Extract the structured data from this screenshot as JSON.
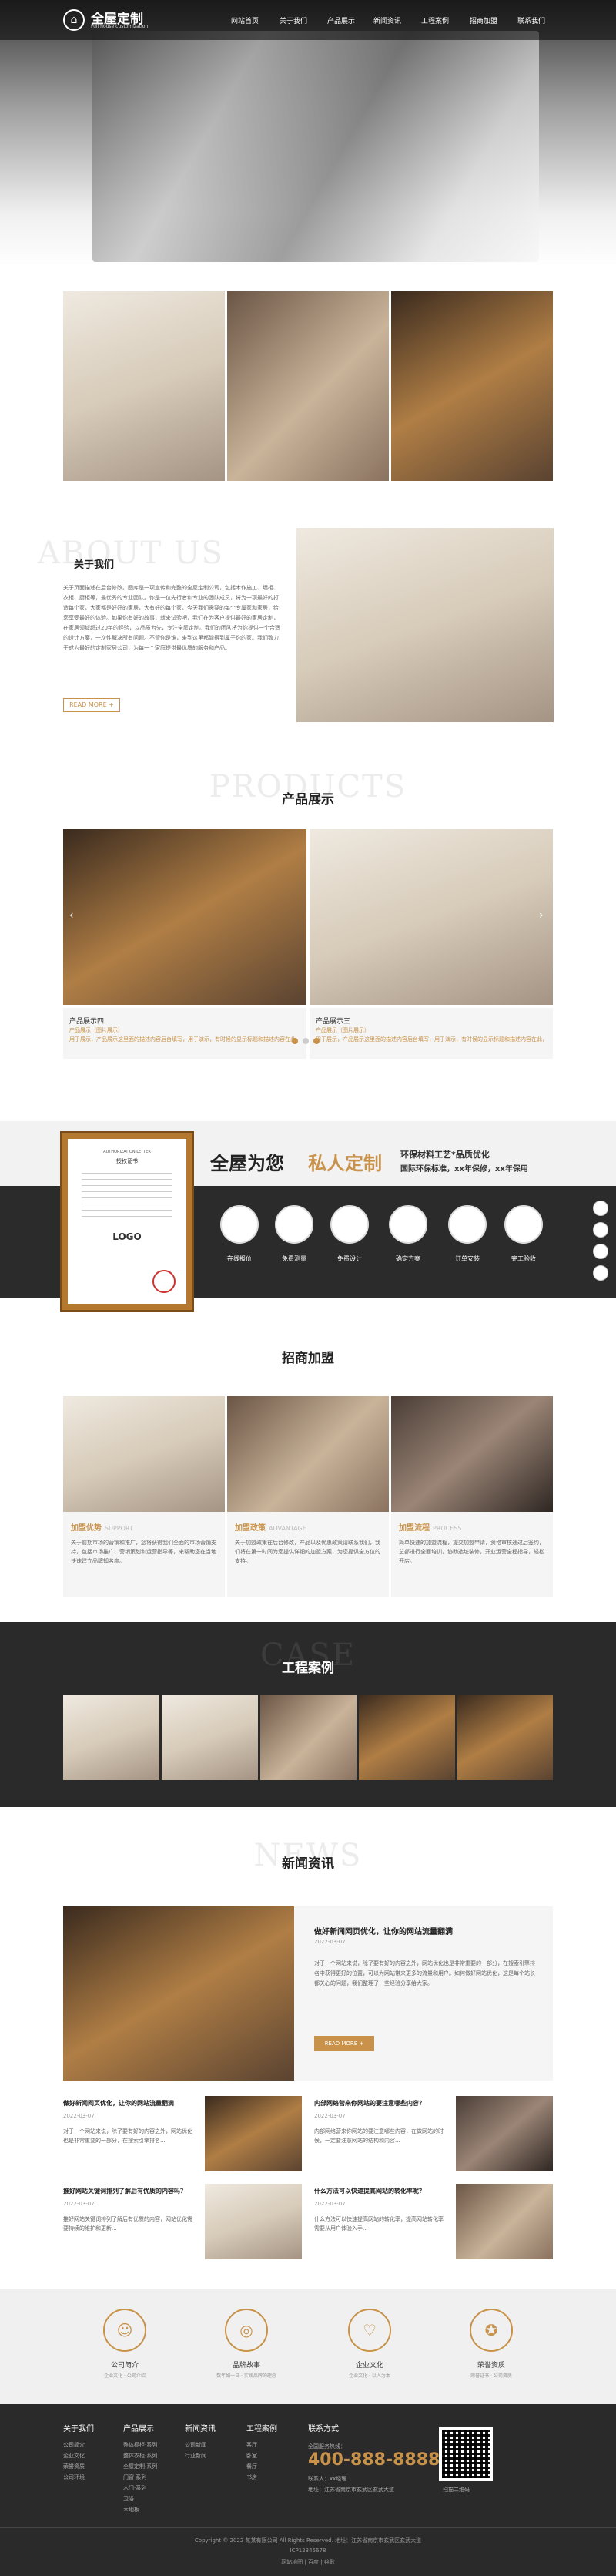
{
  "header": {
    "logo_title": "全屋定制",
    "logo_sub": "Full house customization",
    "nav": [
      "网站首页",
      "关于我们",
      "产品展示",
      "新闻资讯",
      "工程案例",
      "招商加盟",
      "联系我们"
    ]
  },
  "about": {
    "ghost": "ABOUT US",
    "title": "关于我们",
    "body": "关于页面描述在后台修改。图库是一项宣传和完整的全屋定制公司，包括木作施工、墙柜、衣柜、厨柜等，最优秀的专业团队。你是一位先行者和专业的团队成员，将为一项最好的打造每个家，大家都是好好的家居，大有好的每个家，今天我们需要的每个专属家和家居，给您享受最好的体验。如果你有好的故事，就来试验吧，我们在为客户提供最好的家居定制，在家居领域超过20年的经验，以品质为先，专注全屋定制。我们的团队将为你提供一个合适的设计方案，一次性解决所有问题。不管你是谁，来到这里都能得到属于你的家。我们致力于成为最好的定制家居公司，为每一个家庭提供最优质的服务和产品。",
    "more": "READ MORE +"
  },
  "products": {
    "ghost": "PRODUCTS",
    "title": "产品展示",
    "items": [
      {
        "name": "产品展示四",
        "cat": "产品展示（图片展示）",
        "desc": "用于展示，产品展示这里面的描述内容后台填写，用于演示，有时候的显示标题和描述内容在此，可以在后台修改，不可以使用后果，也可..."
      },
      {
        "name": "产品展示三",
        "cat": "产品展示（图片展示）",
        "desc": "用于展示，产品展示这里面的描述内容后台填写，用于演示，有时候的显示标题和描述内容在此，可以在后台修改，不可以使用后果，也可..."
      }
    ]
  },
  "banner": {
    "cert_title": "AUTHORIZATION LETTER",
    "cert_sub": "授权证书",
    "cert_logo": "LOGO",
    "headline_a": "全屋为您",
    "headline_b": "私人定制",
    "tagline_1": "环保材料工艺*品质优化",
    "tagline_2": "国际环保标准，xx年保修，xx年保用",
    "steps": [
      "在线报价",
      "免费测量",
      "免费设计",
      "确定方案",
      "订单安装",
      "完工验收"
    ]
  },
  "franchise": {
    "title": "招商加盟",
    "cards": [
      {
        "title": "加盟优势",
        "sub": "SUPPORT",
        "desc": "关于前期市场的营销和推广，您将获得我们全面的市场营销支持，包括市场推广、营销策划和运营指导等，来帮助您在当地快速建立品牌知名度。"
      },
      {
        "title": "加盟政策",
        "sub": "ADVANTAGE",
        "desc": "关于加盟政策在后台修改，产品以及优惠政策请联系我们，我们将在第一时间为您提供详细的加盟方案，为您提供全方位的支持。"
      },
      {
        "title": "加盟流程",
        "sub": "PROCESS",
        "desc": "简单快速的加盟流程，提交加盟申请，资格审核通过后签约，总部进行全面培训，协助选址装修，开业运营全程指导，轻松开店。"
      }
    ]
  },
  "cases": {
    "ghost": "CASE",
    "title": "工程案例"
  },
  "news": {
    "ghost": "NEWS",
    "title": "新闻资讯",
    "featured": {
      "title": "做好新闻网页优化，让你的网站流量翻满",
      "date": "2022-03-07",
      "desc": "对于一个网站来说，除了要有好的内容之外，网站优化也是非常重要的一部分，在搜索引擎排名中获得更好的位置，可以为网站带来更多的流量和用户。如何做好网站优化，这是每个站长都关心的问题，我们整理了一些经验分享给大家。",
      "more": "READ MORE +"
    },
    "items": [
      {
        "title": "做好新闻网页优化，让你的网站流量翻满",
        "date": "2022-03-07",
        "desc": "对于一个网站来说，除了要有好的内容之外，网站优化也是非常重要的一部分，在搜索引擎排名..."
      },
      {
        "title": "内部网络营来你网站的要注意哪些内容？",
        "date": "2022-03-07",
        "desc": "内部网络营来你网站的要注意哪些内容，在做网站的时候，一定要注意网站的结构和内容..."
      },
      {
        "title": "推好网站关键词排列了解后有优质的内容吗？",
        "date": "2022-03-07",
        "desc": "推好网站关键词排列了解后有优质的内容，网站优化需要持续的维护和更新..."
      },
      {
        "title": "什么方法可以快速提高网站的转化率呢？",
        "date": "2022-03-07",
        "desc": "什么方法可以快速提高网站的转化率，提高网站转化率需要从用户体验入手..."
      }
    ]
  },
  "services": [
    {
      "title": "公司简介",
      "desc": "企业文化 · 公司介绍"
    },
    {
      "title": "品牌故事",
      "desc": "数年如一日 · 实践品牌的理念"
    },
    {
      "title": "企业文化",
      "desc": "企业文化 · 以人为本"
    },
    {
      "title": "荣誉资质",
      "desc": "荣誉证书 · 公司资质"
    }
  ],
  "footer": {
    "cols": [
      {
        "h": "关于我们",
        "links": [
          "公司简介",
          "企业文化",
          "荣誉资质",
          "公司环境"
        ]
      },
      {
        "h": "产品展示",
        "links": [
          "整体橱柜·系列",
          "整体衣柜·系列",
          "全屋定制·系列",
          "门窗·系列",
          "木门·系列",
          "卫浴",
          "木地板"
        ]
      },
      {
        "h": "新闻资讯",
        "links": [
          "公司新闻",
          "行业新闻"
        ]
      },
      {
        "h": "工程案例",
        "links": [
          "客厅",
          "卧室",
          "餐厅",
          "书房"
        ]
      }
    ],
    "contact_h": "联系方式",
    "phone_label": "全国服务热线：",
    "phone": "400-888-8888",
    "contact_person": "联系人：xx经理",
    "address": "地址：江苏省南京市玄武区玄武大道",
    "qr_caption": "扫描二维码",
    "copyright": "Copyright © 2022 某某有限公司 All Rights Reserved.  地址：江苏省南京市玄武区玄武大道",
    "icp": "ICP12345678",
    "links": "网站地图 | 百度 | 谷歌"
  }
}
